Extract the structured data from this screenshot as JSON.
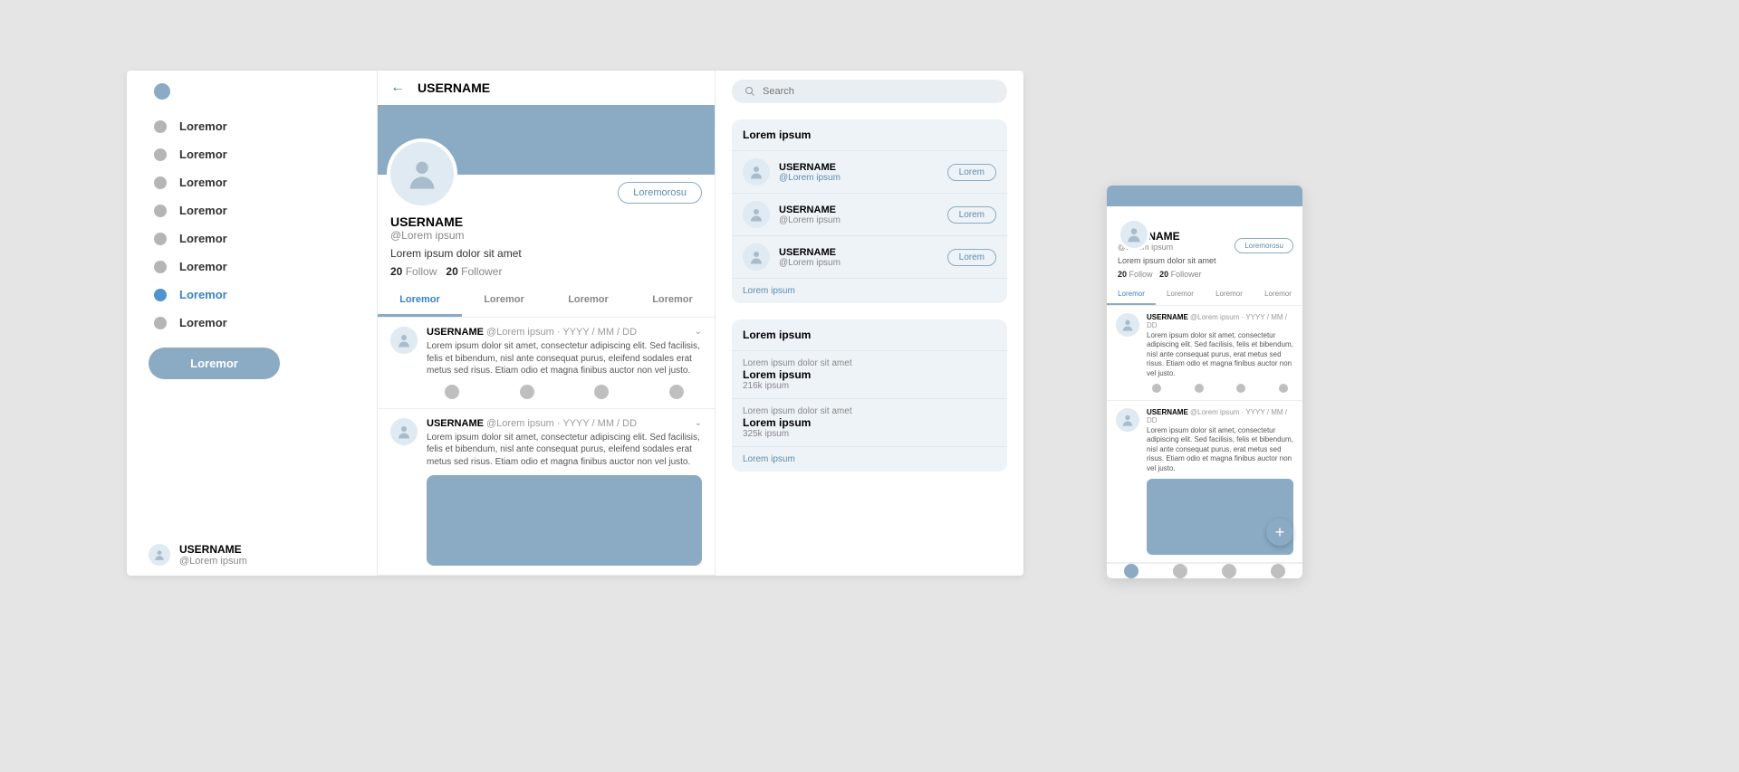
{
  "sidebar": {
    "items": [
      {
        "label": "Loremor"
      },
      {
        "label": "Loremor"
      },
      {
        "label": "Loremor"
      },
      {
        "label": "Loremor"
      },
      {
        "label": "Loremor"
      },
      {
        "label": "Loremor"
      },
      {
        "label": "Loremor"
      },
      {
        "label": "Loremor"
      }
    ],
    "active_index": 6,
    "compose_label": "Loremor",
    "user": {
      "name": "USERNAME",
      "handle": "@Lorem ipsum"
    }
  },
  "main": {
    "title": "USERNAME",
    "profile": {
      "name": "USERNAME",
      "handle": "@Lorem ipsum",
      "bio": "Lorem ipsum dolor sit amet",
      "follow_count": "20",
      "follow_label": "Follow",
      "follower_count": "20",
      "follower_label": "Follower",
      "action_label": "Loremorosu"
    },
    "tabs": [
      {
        "label": "Loremor"
      },
      {
        "label": "Loremor"
      },
      {
        "label": "Loremor"
      },
      {
        "label": "Loremor"
      }
    ],
    "active_tab": 0,
    "posts": [
      {
        "author": "USERNAME",
        "handle": "@Lorem ipsum",
        "date": "YYYY / MM / DD",
        "text": "Lorem ipsum dolor sit amet, consectetur adipiscing elit. Sed facilisis, felis et bibendum, nisl ante consequat purus, eleifend sodales erat metus sed risus. Etiam odio et magna finibus auctor non vel justo.",
        "has_media": false
      },
      {
        "author": "USERNAME",
        "handle": "@Lorem ipsum",
        "date": "YYYY / MM / DD",
        "text": "Lorem ipsum dolor sit amet, consectetur adipiscing elit. Sed facilisis, felis et bibendum, nisl ante consequat purus, eleifend sodales erat metus sed risus. Etiam odio et magna finibus auctor non vel justo.",
        "has_media": true
      }
    ]
  },
  "aside": {
    "search_placeholder": "Search",
    "suggest": {
      "title": "Lorem ipsum",
      "items": [
        {
          "name": "USERNAME",
          "handle": "@Lorem ipsum",
          "btn": "Lorem",
          "blue": true
        },
        {
          "name": "USERNAME",
          "handle": "@Lorem ipsum",
          "btn": "Lorem",
          "blue": false
        },
        {
          "name": "USERNAME",
          "handle": "@Lorem ipsum",
          "btn": "Lorem",
          "blue": false
        }
      ],
      "footer": "Lorem ipsum"
    },
    "trends": {
      "title": "Lorem ipsum",
      "items": [
        {
          "context": "Lorem ipsum dolor sit amet",
          "name": "Lorem ipsum",
          "count": "216k ipsum"
        },
        {
          "context": "Lorem ipsum dolor sit amet",
          "name": "Lorem ipsum",
          "count": "325k ipsum"
        }
      ],
      "footer": "Lorem ipsum"
    }
  },
  "mobile": {
    "profile": {
      "name": "USERNAME",
      "handle": "@Lorem ipsum",
      "bio": "Lorem ipsum dolor sit amet",
      "follow_count": "20",
      "follow_label": "Follow",
      "follower_count": "20",
      "follower_label": "Follower",
      "action_label": "Loremorosu"
    },
    "tabs": [
      {
        "label": "Loremor"
      },
      {
        "label": "Loremor"
      },
      {
        "label": "Loremor"
      },
      {
        "label": "Loremor"
      }
    ],
    "posts": [
      {
        "author": "USERNAME",
        "handle": "@Lorem ipsum",
        "date": "YYYY / MM / DD",
        "text": "Lorem ipsum dolor sit amet, consectetur adipiscing elit. Sed facilisis, felis et bibendum, nisl ante consequat purus, erat metus sed risus. Etiam odio et magna finibus auctor non vel justo."
      },
      {
        "author": "USERNAME",
        "handle": "@Lorem ipsum",
        "date": "YYYY / MM / DD",
        "text": "Lorem ipsum dolor sit amet, consectetur adipiscing elit. Sed facilisis, felis et bibendum, nisl ante consequat purus, erat metus sed risus. Etiam odio et magna finibus auctor non vel justo."
      }
    ]
  }
}
